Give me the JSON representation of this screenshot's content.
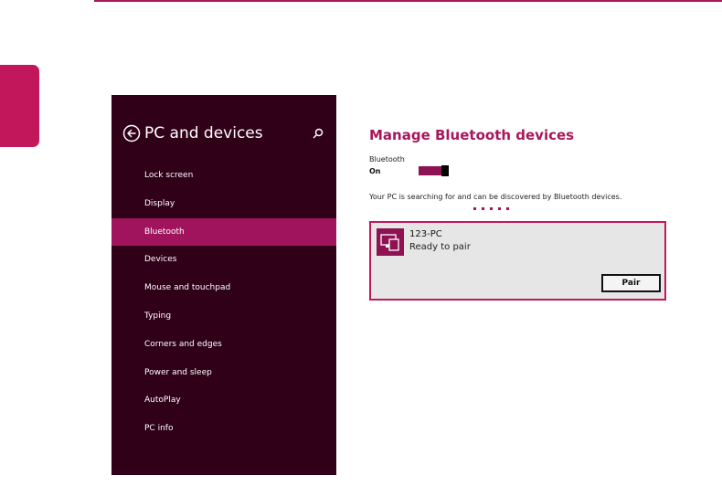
{
  "colors": {
    "accent": "#a8175a",
    "panel_bg": "#300018",
    "active_item": "#a0145e"
  },
  "sidebar": {
    "title": "PC and devices",
    "back_icon": "back-arrow-icon",
    "search_icon": "search-icon",
    "items": [
      {
        "label": "Lock screen"
      },
      {
        "label": "Display"
      },
      {
        "label": "Bluetooth",
        "selected": true
      },
      {
        "label": "Devices"
      },
      {
        "label": "Mouse and touchpad"
      },
      {
        "label": "Typing"
      },
      {
        "label": "Corners and edges"
      },
      {
        "label": "Power and sleep"
      },
      {
        "label": "AutoPlay"
      },
      {
        "label": "PC info"
      }
    ]
  },
  "main": {
    "heading": "Manage Bluetooth devices",
    "bluetooth_label": "Bluetooth",
    "bluetooth_state": "On",
    "toggle_on": true,
    "status_text": "Your PC is searching for and can be discovered by Bluetooth devices."
  },
  "device": {
    "name": "123-PC",
    "status": "Ready to pair",
    "icon": "device-pc-icon",
    "pair_label": "Pair"
  }
}
